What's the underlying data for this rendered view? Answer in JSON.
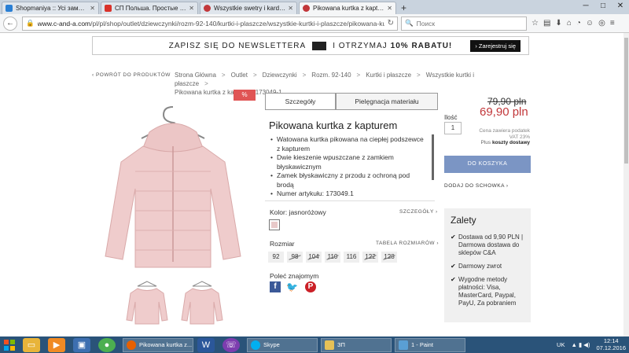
{
  "browser": {
    "tabs": [
      {
        "title": "Shopmaniya :: Усі замовле...",
        "color": "#2a7fd4"
      },
      {
        "title": "СП Польша. Простые усл...",
        "color": "#d9322a"
      },
      {
        "title": "Wszystkie swetry i kardigan...",
        "color": "#c2373a"
      },
      {
        "title": "Pikowana kurtka z kapturem...",
        "color": "#c2373a"
      }
    ],
    "new_tab": "+",
    "url_domain": "www.c-and-a.com",
    "url_path": "/pl/pl/shop/outlet/dziewczynki/rozm-92-140/kurtki-i-plaszcze/wszystkie-kurtki-i-plaszcze/pikowana-kurtka-z-kapturem-173049-1",
    "search_placeholder": "Поиск",
    "win_min": "─",
    "win_max": "□",
    "win_close": "✕"
  },
  "newsletter": {
    "text_before": "ZAPISZ SIĘ DO NEWSLETTERA",
    "text_after": "I OTRZYMAJ",
    "bold": "10% RABATU!",
    "button": "› Zarejestruj się"
  },
  "back_link": "‹ POWRÓT DO PRODUKTÓW",
  "breadcrumb": [
    "Strona Główna",
    "Outlet",
    "Dziewczynki",
    "Rozm. 92-140",
    "Kurtki i płaszcze",
    "Wszystkie kurtki i płaszcze",
    "Pikowana kurtka z kapturem 173049-1"
  ],
  "badge": "%",
  "product_tabs": [
    "Szczegóły",
    "Pielęgnacja materiału"
  ],
  "product": {
    "title": "Pikowana kurtka z kapturem",
    "features": [
      "Watowana kurtka pikowana na ciepłej podszewce z kapturem",
      "Dwie kieszenie wpuszczane z zamkiem błyskawicznym",
      "Zamek błyskawiczny z przodu z ochroną pod brodą",
      "Numer artykułu: 173049.1"
    ],
    "color_label": "Kolor: jasnoróżowy",
    "color_hex": "#e8c9c9",
    "details_link": "SZCZEGÓŁY ›",
    "size_label": "Rozmiar",
    "size_table_link": "TABELA ROZMIARÓW ›",
    "sizes": [
      {
        "label": "92",
        "available": true
      },
      {
        "label": "98",
        "available": false
      },
      {
        "label": "104",
        "available": false
      },
      {
        "label": "110",
        "available": false
      },
      {
        "label": "116",
        "available": true
      },
      {
        "label": "122",
        "available": false
      },
      {
        "label": "128",
        "available": false
      }
    ],
    "share_label": "Poleć znajomym",
    "share_icons": [
      "facebook-icon",
      "twitter-icon",
      "pinterest-icon"
    ]
  },
  "purchase": {
    "old_price": "79,90 pln",
    "new_price": "69,90 pln",
    "qty_label": "Ilość",
    "qty_value": "1",
    "vat_line1": "Cena zawiera podatek",
    "vat_line2": "VAT 23%",
    "ship_plus": "Plus",
    "ship_link": "koszty dostawy",
    "cart_button": "DO KOSZYKA",
    "wishlist": "DODAJ DO SCHOWKA ›"
  },
  "zalety": {
    "title": "Zalety",
    "items": [
      "Dostawa od 9,90 PLN | Darmowa dostawa do sklepów C&A",
      "Darmowy zwrot",
      "Wygodne metody płatności: Visa, MasterCard, Paypal, PayU, Za pobraniem"
    ]
  },
  "taskbar": {
    "buttons": [
      {
        "label": "Pikowana kurtka z...",
        "color": "#e66000"
      },
      {
        "label": "Skype",
        "color": "#00aff0"
      },
      {
        "label": "ЗП",
        "color": "#e7c157"
      },
      {
        "label": "1 - Paint",
        "color": "#5a9fd4"
      }
    ],
    "lang": "UK",
    "time": "12:14",
    "date": "07.12.2016"
  }
}
